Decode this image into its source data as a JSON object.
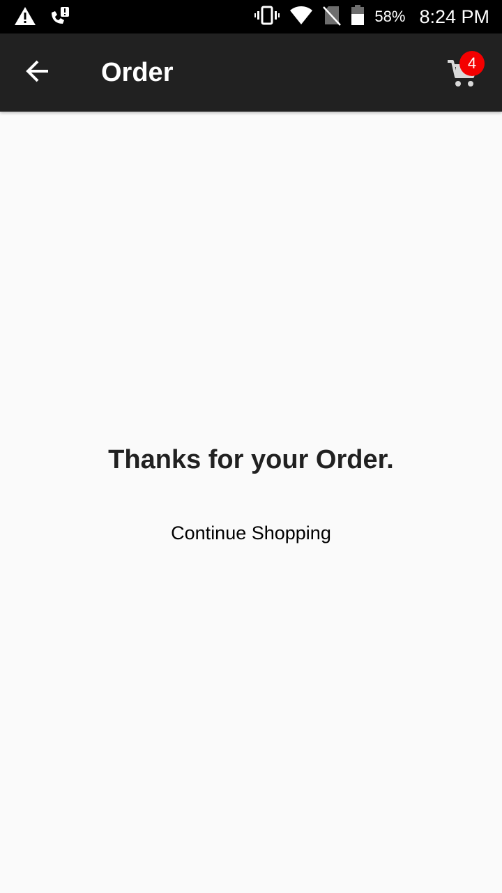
{
  "status_bar": {
    "icons_left": [
      "warning-icon",
      "phone-alert-icon"
    ],
    "icons_right": [
      "vibrate-icon",
      "wifi-icon",
      "no-sim-icon",
      "battery-icon"
    ],
    "battery_percent": "58%",
    "time": "8:24 PM"
  },
  "app_bar": {
    "back_icon": "arrow-left-icon",
    "title": "Order",
    "cart_icon": "cart-icon",
    "cart_count": "4",
    "badge_color": "#f40000"
  },
  "main": {
    "message": "Thanks for your Order.",
    "continue_label": "Continue Shopping"
  },
  "colors": {
    "app_bar": "#212121",
    "status_bar": "#000000",
    "background": "#fafafa"
  }
}
